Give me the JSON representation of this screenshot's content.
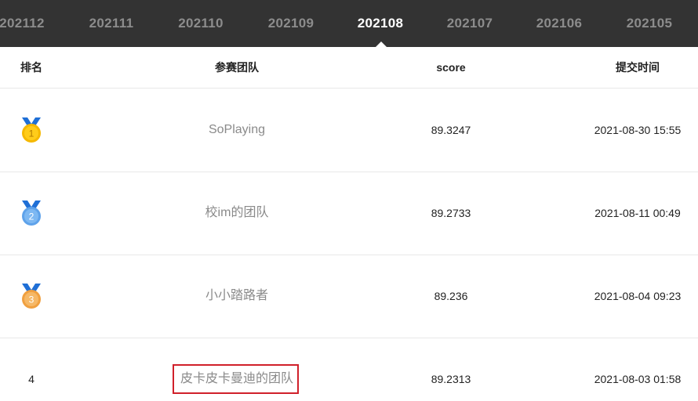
{
  "tabs": [
    {
      "label": "202112",
      "active": false
    },
    {
      "label": "202111",
      "active": false
    },
    {
      "label": "202110",
      "active": false
    },
    {
      "label": "202109",
      "active": false
    },
    {
      "label": "202108",
      "active": true
    },
    {
      "label": "202107",
      "active": false
    },
    {
      "label": "202106",
      "active": false
    },
    {
      "label": "202105",
      "active": false
    }
  ],
  "table": {
    "headers": {
      "rank": "排名",
      "team": "参赛团队",
      "score": "score",
      "time": "提交时间"
    },
    "rows": [
      {
        "rank": "1",
        "medal": "gold",
        "team": "SoPlaying",
        "score": "89.3247",
        "time": "2021-08-30 15:55"
      },
      {
        "rank": "2",
        "medal": "silver",
        "team": "校im的团队",
        "score": "89.2733",
        "time": "2021-08-11 00:49"
      },
      {
        "rank": "3",
        "medal": "bronze",
        "team": "小小踏路者",
        "score": "89.236",
        "time": "2021-08-04 09:23"
      },
      {
        "rank": "4",
        "medal": "",
        "team": "皮卡皮卡曼迪的团队",
        "score": "89.2313",
        "time": "2021-08-03 01:58"
      }
    ]
  },
  "colors": {
    "tabbar_bg": "#333333",
    "tab_inactive": "#8c8c8c",
    "tab_active": "#ffffff",
    "medal_ribbon": "#1f6fd6",
    "gold": "#f5b800",
    "silver": "#5ea2ea",
    "bronze": "#f0a040",
    "highlight": "#d0202a"
  }
}
